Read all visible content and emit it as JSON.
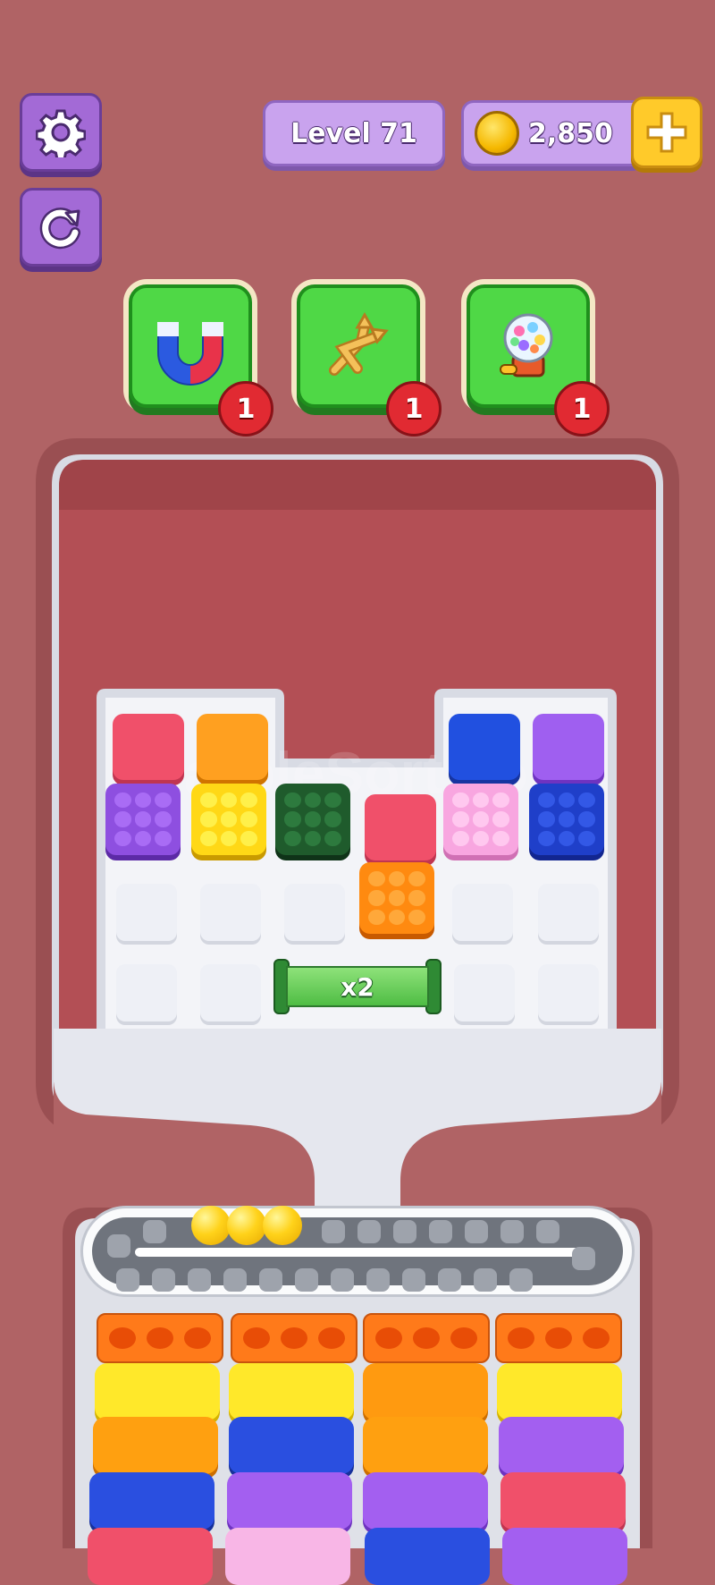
{
  "hud": {
    "level_label": "Level 71",
    "coins": "2,850"
  },
  "icons": {
    "settings": "gear-icon",
    "restart": "refresh-icon",
    "coin": "coin-icon",
    "add_coins": "plus-icon"
  },
  "boosters": [
    {
      "name": "magnet",
      "icon": "magnet-icon",
      "count": "1"
    },
    {
      "name": "shuffle",
      "icon": "shuffle-arrows-icon",
      "count": "1"
    },
    {
      "name": "gumball",
      "icon": "gumball-machine-icon",
      "count": "1"
    }
  ],
  "board": {
    "multiplier_label": "x2",
    "watermark": "MarbleSort.com"
  },
  "colors": {
    "background": "#b06365",
    "red": "#f0506a",
    "orange": "#ff8a10",
    "purple": "#8e4fe0",
    "yellow": "#ffe02a",
    "green": "#1f5b2c",
    "pink": "#f8a6e0",
    "blue": "#1f3fc9",
    "ball": "#ffd21a"
  }
}
